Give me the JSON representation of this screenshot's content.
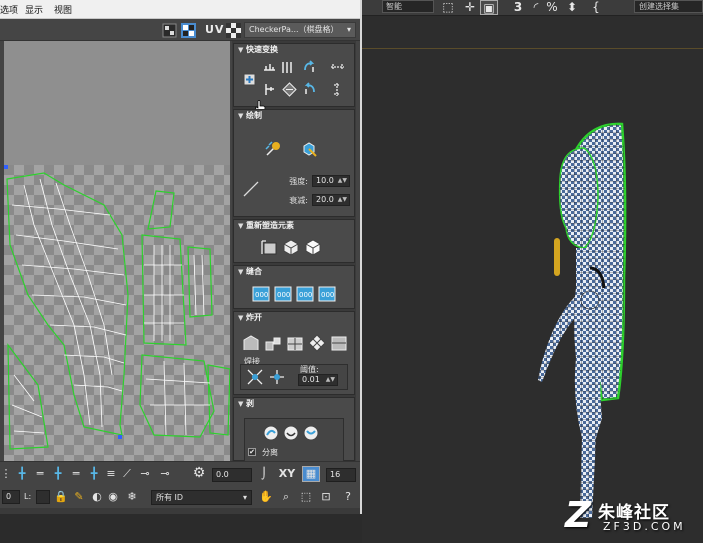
{
  "menu": {
    "items": [
      "选项",
      "显示",
      "视图"
    ]
  },
  "uv_toolbar": {
    "uv_label": "UV",
    "checker_select": "CheckerPa...（棋盘格）"
  },
  "panel": {
    "quick_transform": {
      "title": "快速变换"
    },
    "brush": {
      "title": "绘制",
      "strength_label": "强度:",
      "strength_value": "10.0",
      "falloff_label": "衰减:",
      "falloff_value": "20.0"
    },
    "reshape": {
      "title": "重新塑造元素"
    },
    "stitch": {
      "title": "缝合"
    },
    "explode": {
      "title": "炸开",
      "weld_label": "焊接",
      "threshold_label": "阈值:",
      "threshold_value": "0.01"
    },
    "peel": {
      "title": "剥",
      "split_label": "分离",
      "split_checked": "✔"
    }
  },
  "bottom": {
    "rotation_value": "0.0",
    "xy_label": "XY",
    "grid_value": "16",
    "coord_label": "0",
    "l_label": "L:",
    "id_select": "所有 ID"
  },
  "viewport": {
    "select_value": "智能",
    "named_set": "创建选择集"
  },
  "watermark": {
    "mark": "Z",
    "cn": "朱峰社区",
    "en": "ZF3D.COM"
  },
  "colors": {
    "seam_green": "#2dd12d",
    "uv_white": "#ffffff",
    "checker_light": "#a3a3a3",
    "checker_dark": "#8a8a8a",
    "panel_bg": "#4a4a4a",
    "active_blue": "#4a8ccf",
    "gold": "#d4a520"
  }
}
